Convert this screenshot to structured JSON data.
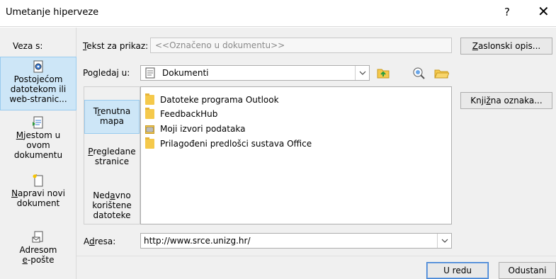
{
  "window": {
    "title": "Umetanje hiperveze",
    "help_label": "?",
    "close_label": "✕"
  },
  "left_panel": {
    "header": "Veza s:",
    "items": [
      {
        "label_lines": [
          "Postojećom",
          "datotekom ili",
          "web-stranic..."
        ],
        "icon": "existing-file-icon",
        "selected": true
      },
      {
        "label_lines": [
          "Mjestom u",
          "ovom",
          "dokumentu"
        ],
        "icon": "place-in-document-icon",
        "selected": false
      },
      {
        "label_lines": [
          "Napravi novi",
          "dokument"
        ],
        "icon": "new-document-icon",
        "selected": false
      },
      {
        "label_lines": [
          "Adresom",
          "e-pošte"
        ],
        "icon": "email-address-icon",
        "selected": false
      }
    ]
  },
  "text_to_display": {
    "label": "Tekst za prikaz:",
    "value": "<<Označeno u dokumentu>>"
  },
  "screentip_button": "Zaslonski opis...",
  "look_in": {
    "label": "Pogledaj u:",
    "value": "Dokumenti",
    "icons": [
      "up-folder-icon",
      "browse-web-icon",
      "browse-file-icon"
    ]
  },
  "look_panel": {
    "items": [
      {
        "label_lines": [
          "Trenutna",
          "mapa"
        ],
        "selected": true
      },
      {
        "label_lines": [
          "Pregledane",
          "stranice"
        ],
        "selected": false
      },
      {
        "label_lines": [
          "Nedavno",
          "korištene",
          "datoteke"
        ],
        "selected": false
      }
    ]
  },
  "files": [
    {
      "name": "Datoteke programa Outlook",
      "icon": "folder-icon"
    },
    {
      "name": "FeedbackHub",
      "icon": "folder-icon"
    },
    {
      "name": "Moji izvori podataka",
      "icon": "data-source-folder-icon"
    },
    {
      "name": "Prilagođeni predlošci sustava Office",
      "icon": "folder-icon"
    }
  ],
  "bookmark_button": "Knjižna oznaka...",
  "address": {
    "label": "Adresa:",
    "value": "http://www.srce.unizg.hr/"
  },
  "ok_button": "U redu",
  "cancel_button": "Odustani",
  "colors": {
    "selected_bg": "#cde6f7",
    "selected_border": "#99cbee",
    "dialog_bg": "#f0f0f0",
    "primary_border": "#3b7fd4",
    "folder": "#f5c94b"
  }
}
